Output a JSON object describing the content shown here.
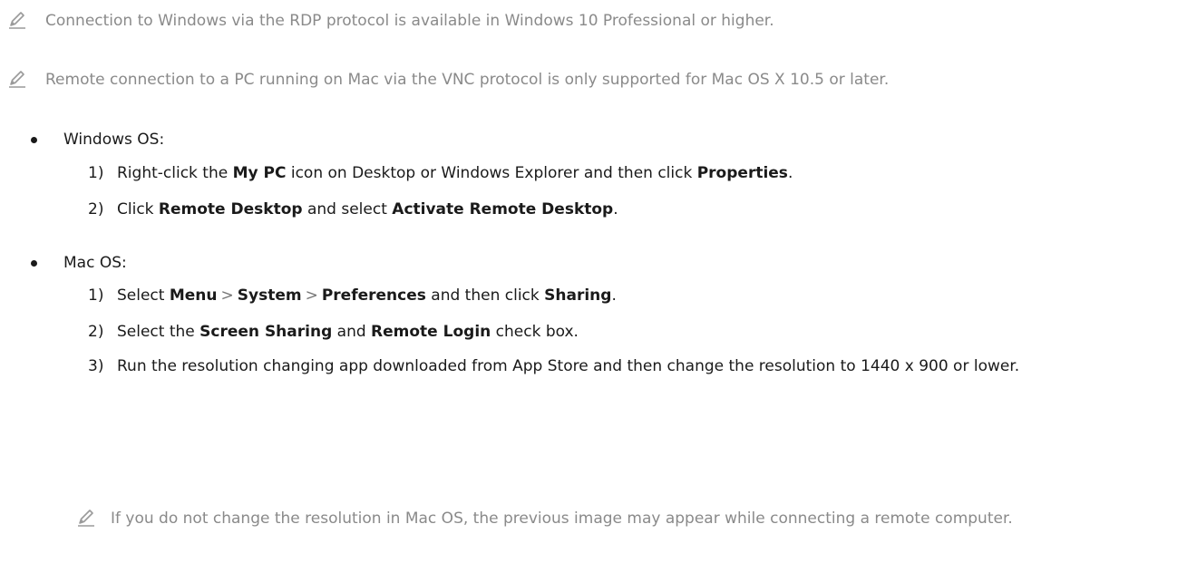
{
  "notes": [
    {
      "icon": "pencil-icon",
      "text": "Connection to Windows via the RDP protocol is available in Windows 10 Professional or higher."
    },
    {
      "icon": "pencil-icon",
      "text": "Remote connection to a PC running on Mac via the VNC protocol is only supported for Mac OS X 10.5 or later."
    }
  ],
  "windows": {
    "heading": "Windows OS:",
    "steps": [
      {
        "num": "1)",
        "parts": [
          "Right-click the ",
          "My PC",
          " icon on Desktop or Windows Explorer and then click ",
          "Properties",
          "."
        ]
      },
      {
        "num": "2)",
        "parts": [
          "Click ",
          "Remote Desktop",
          " and select ",
          "Activate Remote Desktop",
          "."
        ]
      }
    ]
  },
  "mac": {
    "heading": "Mac OS:",
    "steps": [
      {
        "num": "1)",
        "parts": [
          "Select ",
          "Menu",
          ">",
          "System",
          ">",
          "Preferences",
          " and then click ",
          "Sharing",
          "."
        ]
      },
      {
        "num": "2)",
        "parts": [
          "Select the ",
          "Screen Sharing",
          " and ",
          "Remote Login",
          " check box."
        ]
      },
      {
        "num": "3)",
        "text": "Run the resolution changing app downloaded from App Store and then change the resolution to 1440 x 900 or lower."
      }
    ],
    "note": {
      "icon": "pencil-icon",
      "text": "If you do not change the resolution in Mac OS, the previous image may appear while connecting a remote computer."
    }
  }
}
